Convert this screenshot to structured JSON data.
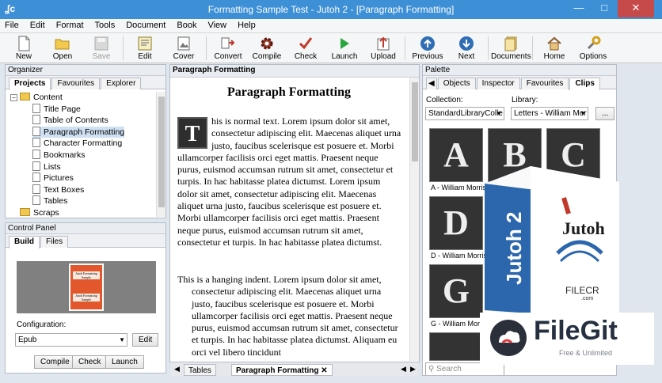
{
  "window": {
    "title": "Formatting Sample Test - Jutoh 2 - [Paragraph Formatting]"
  },
  "menu": [
    "File",
    "Edit",
    "Format",
    "Tools",
    "Document",
    "Book",
    "View",
    "Help"
  ],
  "toolbar": [
    {
      "label": "New",
      "icon": "new-document-icon"
    },
    {
      "label": "Open",
      "icon": "folder-open-icon"
    },
    {
      "label": "Save",
      "icon": "save-icon",
      "disabled": true
    },
    {
      "label": "Edit",
      "icon": "edit-icon"
    },
    {
      "label": "Cover",
      "icon": "cover-icon"
    },
    {
      "label": "Convert",
      "icon": "convert-icon"
    },
    {
      "label": "Compile",
      "icon": "gear-icon"
    },
    {
      "label": "Check",
      "icon": "checkmark-icon"
    },
    {
      "label": "Launch",
      "icon": "play-icon"
    },
    {
      "label": "Upload",
      "icon": "upload-icon"
    },
    {
      "label": "Previous",
      "icon": "arrow-up-icon"
    },
    {
      "label": "Next",
      "icon": "arrow-down-icon"
    },
    {
      "label": "Documents",
      "icon": "documents-icon"
    },
    {
      "label": "Home",
      "icon": "home-icon"
    },
    {
      "label": "Options",
      "icon": "wrench-icon"
    }
  ],
  "organizer": {
    "title": "Organizer",
    "tabs": [
      "Projects",
      "Favourites",
      "Explorer"
    ],
    "tree": [
      {
        "label": "Content",
        "type": "folder",
        "level": 0
      },
      {
        "label": "Title Page",
        "type": "doc",
        "level": 1
      },
      {
        "label": "Table of Contents",
        "type": "doc",
        "level": 1
      },
      {
        "label": "Paragraph Formatting",
        "type": "doc",
        "level": 1,
        "selected": true
      },
      {
        "label": "Character Formatting",
        "type": "doc",
        "level": 1
      },
      {
        "label": "Bookmarks",
        "type": "doc",
        "level": 1
      },
      {
        "label": "Lists",
        "type": "doc",
        "level": 1
      },
      {
        "label": "Pictures",
        "type": "doc",
        "level": 1
      },
      {
        "label": "Text Boxes",
        "type": "doc",
        "level": 1
      },
      {
        "label": "Tables",
        "type": "doc",
        "level": 1
      },
      {
        "label": "Scraps",
        "type": "folder",
        "level": 0
      }
    ]
  },
  "control_panel": {
    "title": "Control Panel",
    "tabs": [
      "Build",
      "Files"
    ],
    "configuration_label": "Configuration:",
    "configuration_value": "Epub",
    "edit_button": "Edit",
    "buttons": [
      "Compile",
      "Check",
      "Launch"
    ],
    "cover_lines": [
      "Jutoh Formatting",
      "Sample",
      "Jutoh Formatting",
      "Sample"
    ]
  },
  "editor": {
    "title": "Paragraph Formatting",
    "heading": "Paragraph Formatting",
    "dropcap": "T",
    "paragraph1": "his is normal text. Lorem ipsum dolor sit amet, consectetur adipiscing elit. Maecenas aliquet urna justo, faucibus scelerisque est posuere et. Morbi ullamcorper facilisis orci eget mattis. Praesent neque purus, euismod accumsan rutrum sit amet, consectetur et turpis. In hac habitasse platea dictumst. Lorem ipsum dolor sit amet, consectetur adipiscing elit. Maecenas aliquet urna justo, faucibus scelerisque est posuere et. Morbi ullamcorper facilisis orci eget mattis. Praesent neque purus, euismod accumsan rutrum sit amet, consectetur et turpis. In hac habitasse platea dictumst.",
    "paragraph2": "This is a hanging indent. Lorem ipsum dolor sit amet, consectetur adipiscing elit. Maecenas aliquet urna justo, faucibus scelerisque est posuere et. Morbi ullamcorper facilisis orci eget mattis. Praesent neque purus, euismod accumsan rutrum sit amet, consectetur et turpis. In hac habitasse platea dictumst. Aliquam eu orci vel libero tincidunt",
    "bottom_tabs": [
      "Tables",
      "Paragraph Formatting"
    ]
  },
  "palette": {
    "title": "Palette",
    "tabs": [
      "Objects",
      "Inspector",
      "Favourites",
      "Clips"
    ],
    "collection_label": "Collection:",
    "collection_value": "StandardLibraryColle",
    "library_label": "Library:",
    "library_value": "Letters - William Mor",
    "more_button": "...",
    "clips": [
      {
        "letter": "A",
        "label": "A - William Morris"
      },
      {
        "letter": "B",
        "label": ""
      },
      {
        "letter": "C",
        "label": ""
      },
      {
        "letter": "D",
        "label": "D - William Morris"
      },
      {
        "letter": "G",
        "label": "G - William Morris"
      }
    ],
    "search_placeholder": "Search"
  },
  "overlay": {
    "box_brand": "Jutoh",
    "box_side": "Jutoh 2",
    "box_watermark": "FILECR",
    "box_watermark_sub": ".com",
    "filegit_name": "FileGit",
    "filegit_tagline": "Free & Unlimited"
  }
}
